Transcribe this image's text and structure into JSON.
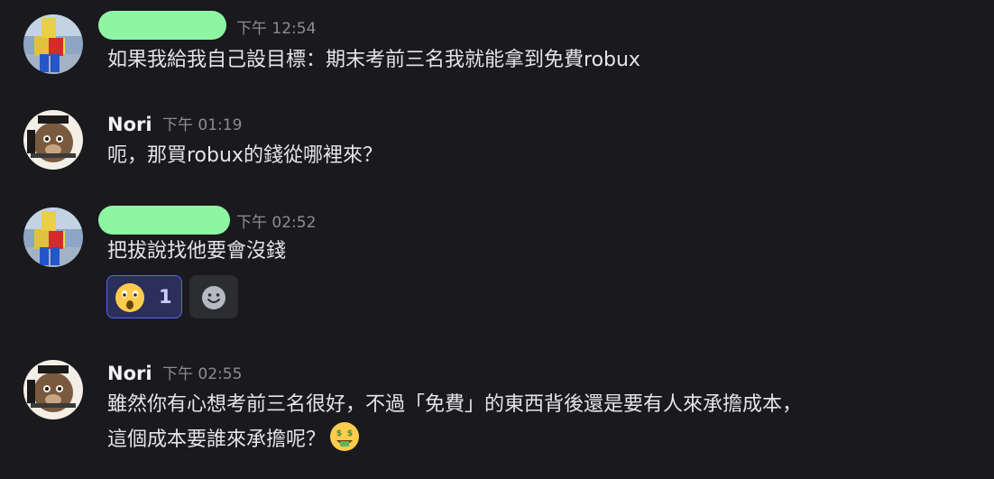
{
  "messages": [
    {
      "author": "",
      "author_redacted": true,
      "timestamp": "下午 12:54",
      "lines": [
        "如果我給我自己設目標：期末考前三名我就能拿到免費robux"
      ]
    },
    {
      "author": "Nori",
      "author_redacted": false,
      "timestamp": "下午 01:19",
      "lines": [
        "呃，那買robux的錢從哪裡來？"
      ]
    },
    {
      "author": "",
      "author_redacted": true,
      "timestamp": "下午 02:52",
      "lines": [
        "把拔說找他要會沒錢"
      ],
      "reaction": {
        "emoji": "astonished-face",
        "count": "1"
      }
    },
    {
      "author": "Nori",
      "author_redacted": false,
      "timestamp": "下午 02:55",
      "lines": [
        "雖然你有心想考前三名很好，不過「免費」的東西背後還是要有人來承擔成本，",
        "這個成本要誰來承擔呢？"
      ],
      "trailing_emoji": "money-mouth-face"
    }
  ],
  "colors": {
    "background": "#1a1a1e",
    "redaction": "#8ef5a2",
    "reaction_border": "#5865f2",
    "timestamp": "#8a8d94"
  }
}
